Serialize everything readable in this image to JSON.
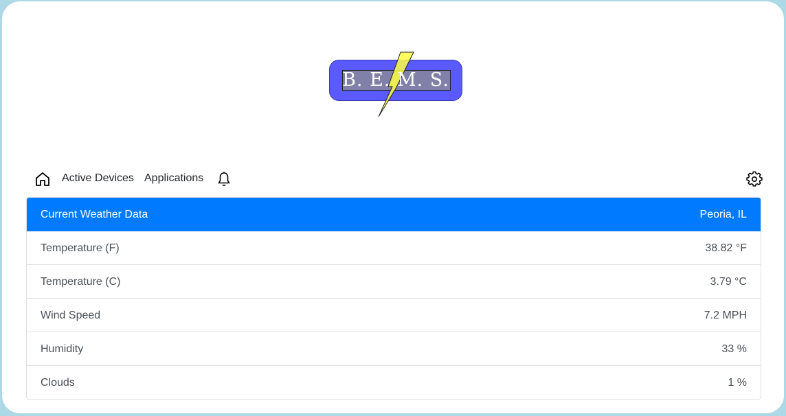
{
  "logo": {
    "text": "B. E. M. S.",
    "colors": {
      "box": "#5a5aff",
      "inner": "#8080a8",
      "bolt": "#ffff44"
    }
  },
  "nav": {
    "home_icon": "home-icon",
    "active_devices": "Active Devices",
    "applications": "Applications",
    "bell_icon": "bell-icon",
    "settings_icon": "gear-icon"
  },
  "weather": {
    "header": {
      "title": "Current Weather Data",
      "location": "Peoria, IL"
    },
    "rows": [
      {
        "label": "Temperature (F)",
        "value": "38.82 °F"
      },
      {
        "label": "Temperature (C)",
        "value": "3.79 °C"
      },
      {
        "label": "Wind Speed",
        "value": "7.2 MPH"
      },
      {
        "label": "Humidity",
        "value": "33 %"
      },
      {
        "label": "Clouds",
        "value": "1 %"
      }
    ],
    "colors": {
      "header_bg": "#007bff",
      "header_text": "#ffffff",
      "row_text": "#495057"
    }
  },
  "page": {
    "background": "#add8e6",
    "card": "#ffffff"
  }
}
